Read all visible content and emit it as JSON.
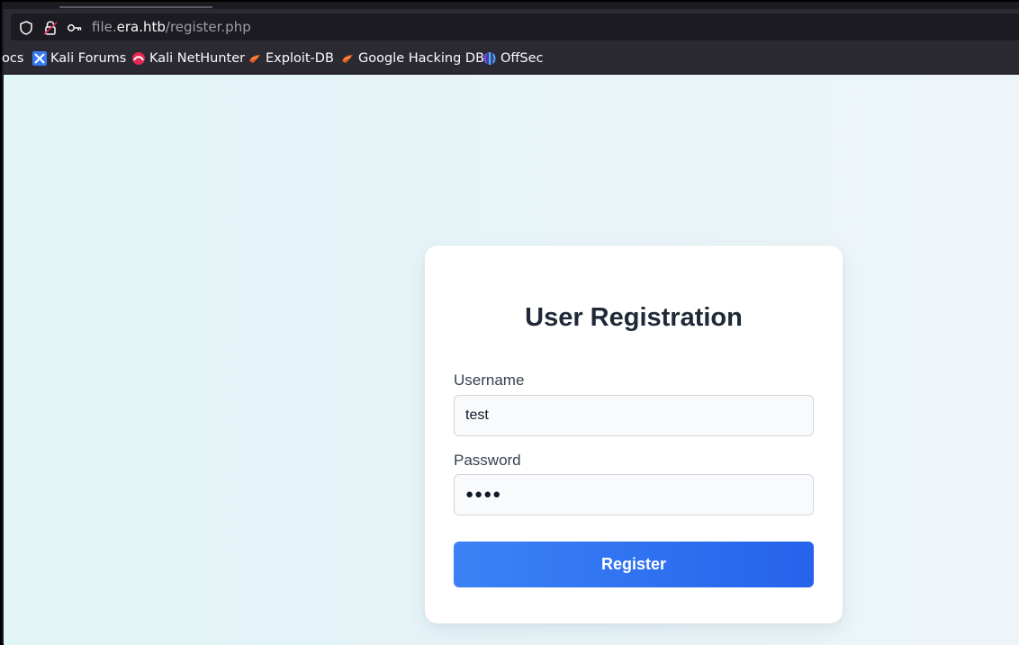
{
  "browser": {
    "url": {
      "prefix": "file.",
      "host": "era.htb",
      "path": "/register.php"
    },
    "bookmarks": [
      {
        "label": "ocs",
        "icon": "none"
      },
      {
        "label": "Kali Forums",
        "icon": "kali-forums-icon"
      },
      {
        "label": "Kali NetHunter",
        "icon": "kali-nethunter-icon"
      },
      {
        "label": "Exploit-DB",
        "icon": "exploit-db-icon"
      },
      {
        "label": "Google Hacking DB",
        "icon": "exploit-db-icon"
      },
      {
        "label": "OffSec",
        "icon": "offsec-icon"
      }
    ]
  },
  "form": {
    "title": "User Registration",
    "username_label": "Username",
    "username_value": "test",
    "password_label": "Password",
    "password_display": "●●●●",
    "submit_label": "Register"
  },
  "colors": {
    "accent_start": "#3b82f6",
    "accent_end": "#2563eb",
    "background": "#e4f5f7"
  }
}
